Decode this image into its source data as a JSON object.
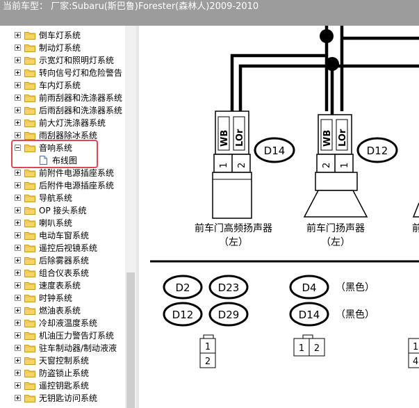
{
  "titlebar": {
    "text": "当前车型： 厂家:Subaru(斯巴鲁)Forester(森林人)2009-2010"
  },
  "tree": {
    "items": [
      {
        "label": "倒车灯系统",
        "expander": "plus"
      },
      {
        "label": "制动灯系统",
        "expander": "plus"
      },
      {
        "label": "示宽灯和照明灯系统",
        "expander": "plus"
      },
      {
        "label": "转向信号灯和危险警告",
        "expander": "plus"
      },
      {
        "label": "车内灯系统",
        "expander": "plus"
      },
      {
        "label": "前雨刮器和洗涤器系统",
        "expander": "plus"
      },
      {
        "label": "后雨刮器和洗涤器系统",
        "expander": "plus"
      },
      {
        "label": "前大灯洗涤器系统",
        "expander": "plus"
      },
      {
        "label": "雨刮器除冰系统",
        "expander": "plus"
      },
      {
        "label": "音响系统",
        "expander": "minus"
      },
      {
        "label": "布线图",
        "child": true
      },
      {
        "label": "前附件电源插座系统",
        "expander": "plus"
      },
      {
        "label": "后附件电源插座系统",
        "expander": "plus"
      },
      {
        "label": "导航系统",
        "expander": "plus"
      },
      {
        "label": "OP 接头系统",
        "expander": "plus"
      },
      {
        "label": "喇叭系统",
        "expander": "plus"
      },
      {
        "label": "电动车窗系统",
        "expander": "plus"
      },
      {
        "label": "遥控后视镜系统",
        "expander": "plus"
      },
      {
        "label": "后除雾器系统",
        "expander": "plus"
      },
      {
        "label": "组合仪表系统",
        "expander": "plus"
      },
      {
        "label": "速度表系统",
        "expander": "plus"
      },
      {
        "label": "时钟系统",
        "expander": "plus"
      },
      {
        "label": "燃油表系统",
        "expander": "plus"
      },
      {
        "label": "冷却液温度系统",
        "expander": "plus"
      },
      {
        "label": "机油压力警告灯系统",
        "expander": "plus"
      },
      {
        "label": "驻车制动器/制动液液",
        "expander": "plus"
      },
      {
        "label": "天窗控制系统",
        "expander": "plus"
      },
      {
        "label": "防盗锁止系统",
        "expander": "plus"
      },
      {
        "label": "遥控钥匙系统",
        "expander": "plus"
      },
      {
        "label": "无钥匙访问系统",
        "expander": "plus"
      }
    ]
  },
  "diagram": {
    "wire_labels": {
      "wb": "WB",
      "lor": "LOr"
    },
    "pins": {
      "one": "1",
      "two": "2",
      "four": "4"
    },
    "conn_d14": "D14",
    "conn_d12": "D12",
    "left_label": "前车门高频扬声器",
    "left_sub": "（左）",
    "right_label": "前车门扬声器",
    "right_sub": "（左）",
    "edge_label": "前",
    "codes": {
      "d2": "D2",
      "d23": "D23",
      "d12": "D12",
      "d29": "D29",
      "d4": "D4",
      "d14": "D14"
    },
    "black1": "（黑色）",
    "black2": "（黑色）"
  }
}
